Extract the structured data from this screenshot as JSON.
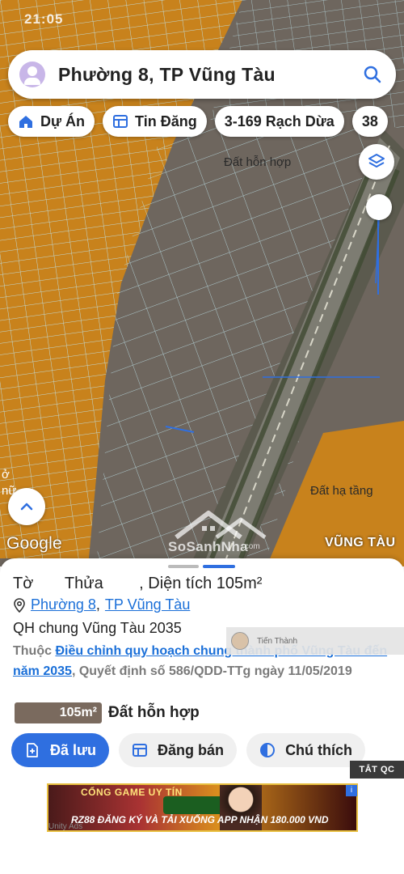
{
  "status_bar": {
    "time": "21:05"
  },
  "search": {
    "title": "Phường 8, TP Vũng Tàu"
  },
  "chips": [
    {
      "label": "Dự Án",
      "icon": "home-icon"
    },
    {
      "label": "Tin Đăng",
      "icon": "listing-icon"
    },
    {
      "label": "3-169 Rạch Dừa",
      "icon": ""
    },
    {
      "label": "38",
      "icon": ""
    }
  ],
  "map": {
    "labels": {
      "mixed_land": "Đất hỗn hợp",
      "infrastructure_land": "Đất hạ tầng",
      "edge_1": "ở",
      "edge_2": "nữ"
    },
    "google": "Google",
    "city": "VŨNG TÀU",
    "watermark": "SoSanhNha",
    "watermark_sub": ".com",
    "colors": {
      "residential": "#c8821c",
      "mixed": "#6e665e",
      "parcel_lines": "#bfe3ea",
      "accent": "#2f6fe0"
    }
  },
  "sheet": {
    "title": "Tờ       Thửa        , Diện tích 105m²",
    "ward": "Phường 8",
    "separator": ",",
    "city": "TP Vũng Tàu",
    "plan_title": "QH chung Vũng Tàu 2035",
    "plan_prefix": "Thuộc ",
    "plan_link": "Điều chỉnh quy hoạch chung thành phố Vũng Tàu đến năm 2035",
    "plan_suffix": ", Quyết định số 586/QDD-TTg ngày 11/05/2019",
    "area_badge": "105m²",
    "land_use": "Đất hỗn hợp"
  },
  "user_tag": {
    "name": "Tiến Thành"
  },
  "actions": [
    {
      "label": "Đã lưu",
      "icon": "saved-icon"
    },
    {
      "label": "Đăng bán",
      "icon": "sell-icon"
    },
    {
      "label": "Chú thích",
      "icon": "legend-icon"
    }
  ],
  "ad": {
    "close_label": "TẮT QC",
    "headline": "CỔNG GAME UY TÍN",
    "subline": "RZ88 ĐĂNG KÝ VÀ TẢI XUỐNG APP NHẬN 180.000 VND",
    "network": "Unity Ads"
  }
}
